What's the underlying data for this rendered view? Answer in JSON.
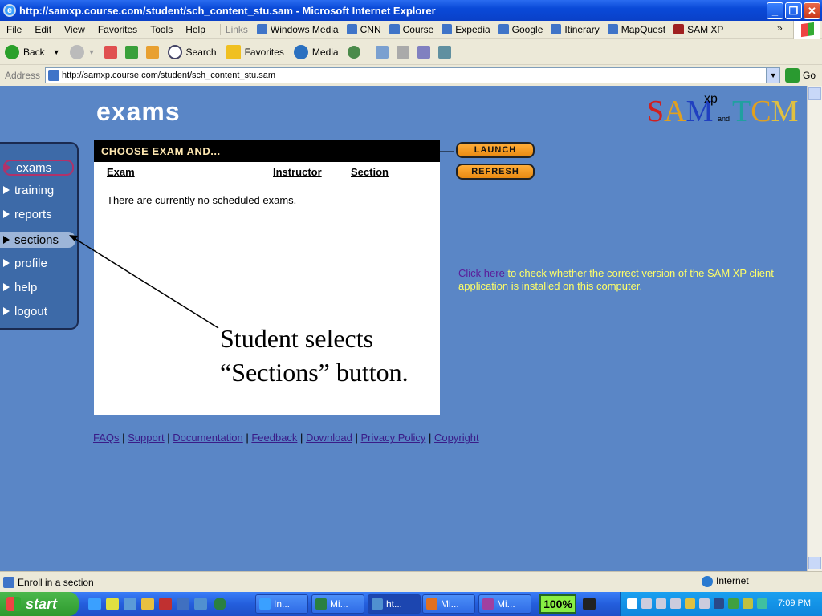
{
  "window": {
    "title": "http://samxp.course.com/student/sch_content_stu.sam - Microsoft Internet Explorer"
  },
  "menu": [
    "File",
    "Edit",
    "View",
    "Favorites",
    "Tools",
    "Help"
  ],
  "links_label": "Links",
  "links": [
    "Windows Media",
    "CNN",
    "Course",
    "Expedia",
    "Google",
    "Itinerary",
    "MapQuest",
    "SAM XP"
  ],
  "toolbar": {
    "back": "Back",
    "search": "Search",
    "favorites": "Favorites",
    "media": "Media"
  },
  "address": {
    "label": "Address",
    "url": "http://samxp.course.com/student/sch_content_stu.sam",
    "go": "Go"
  },
  "page": {
    "heading": "exams",
    "logo": {
      "sam": "SAM",
      "xp": "xp",
      "and": "and",
      "tcm": "TCM"
    },
    "nav": [
      "exams",
      "training",
      "reports",
      "sections",
      "profile",
      "help",
      "logout"
    ],
    "panel_title": "CHOOSE EXAM AND...",
    "columns": [
      "Exam",
      "Instructor",
      "Section"
    ],
    "empty_message": "There are currently no scheduled exams.",
    "launch": "LAUNCH",
    "refresh": "REFRESH",
    "check_link": "Click here",
    "check_text": " to check whether the correct version of the SAM XP client application is installed on this computer.",
    "annotation_line1": "Student selects",
    "annotation_line2": "“Sections” button.",
    "footer_links": [
      "FAQs",
      "Support",
      "Documentation",
      "Feedback",
      "Download",
      "Privacy Policy",
      "Copyright"
    ]
  },
  "status": {
    "text": "Enroll in a section",
    "zone": "Internet"
  },
  "taskbar": {
    "start": "start",
    "tasks": [
      "In...",
      "Mi...",
      "ht...",
      "Mi...",
      "Mi..."
    ],
    "zoom": "100%",
    "clock": "7:09 PM"
  }
}
